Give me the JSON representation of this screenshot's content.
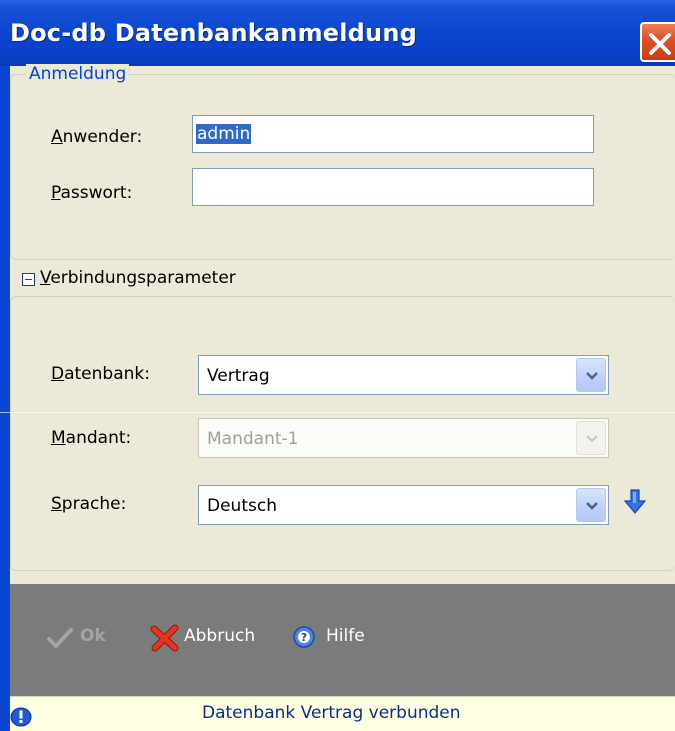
{
  "window": {
    "title": "Doc-db Datenbankanmeldung"
  },
  "login_group": {
    "legend": "Anmeldung",
    "user_label_accel": "A",
    "user_label_rest": "nwender:",
    "user_value": "admin",
    "password_label_accel": "P",
    "password_label_rest": "asswort:",
    "password_value": ""
  },
  "connection_params": {
    "expander_label_accel": "V",
    "expander_label_rest": "erbindungsparameter",
    "expanded": true,
    "database_label_accel": "D",
    "database_label_rest": "atenbank:",
    "database_value": "Vertrag",
    "client_label_accel": "M",
    "client_label_rest": "andant:",
    "client_value": "Mandant-1",
    "client_enabled": false,
    "language_label_accel": "S",
    "language_label_rest": "prache:",
    "language_value": "Deutsch"
  },
  "toolbar": {
    "ok_label": "Ok",
    "ok_enabled": false,
    "cancel_label": "Abbruch",
    "help_label": "Hilfe"
  },
  "status": {
    "text": "Datenbank Vertrag verbunden",
    "icon": "info-icon"
  },
  "colors": {
    "titlebar": "#0a46d0",
    "legend": "#0046d5",
    "toolbar_bg": "#7b7b7b",
    "status_bg": "#ffffe1"
  }
}
